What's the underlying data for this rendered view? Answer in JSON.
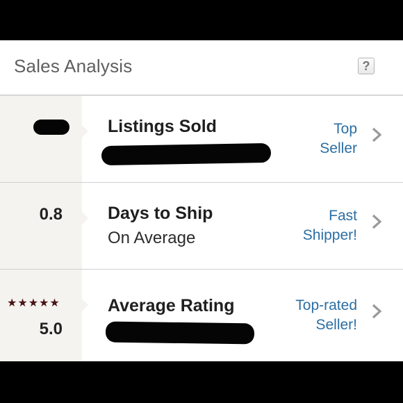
{
  "header": {
    "title": "Sales Analysis",
    "help_label": "?"
  },
  "rows": [
    {
      "title": "Listings Sold",
      "badge_line1": "Top",
      "badge_line2": "Seller"
    },
    {
      "value": "0.8",
      "title": "Days to Ship",
      "subtitle": "On Average",
      "badge_line1": "Fast",
      "badge_line2": "Shipper!"
    },
    {
      "stars": "★★★★★",
      "value": "5.0",
      "title": "Average Rating",
      "badge_line1": "Top-rated",
      "badge_line2": "Seller!"
    }
  ]
}
